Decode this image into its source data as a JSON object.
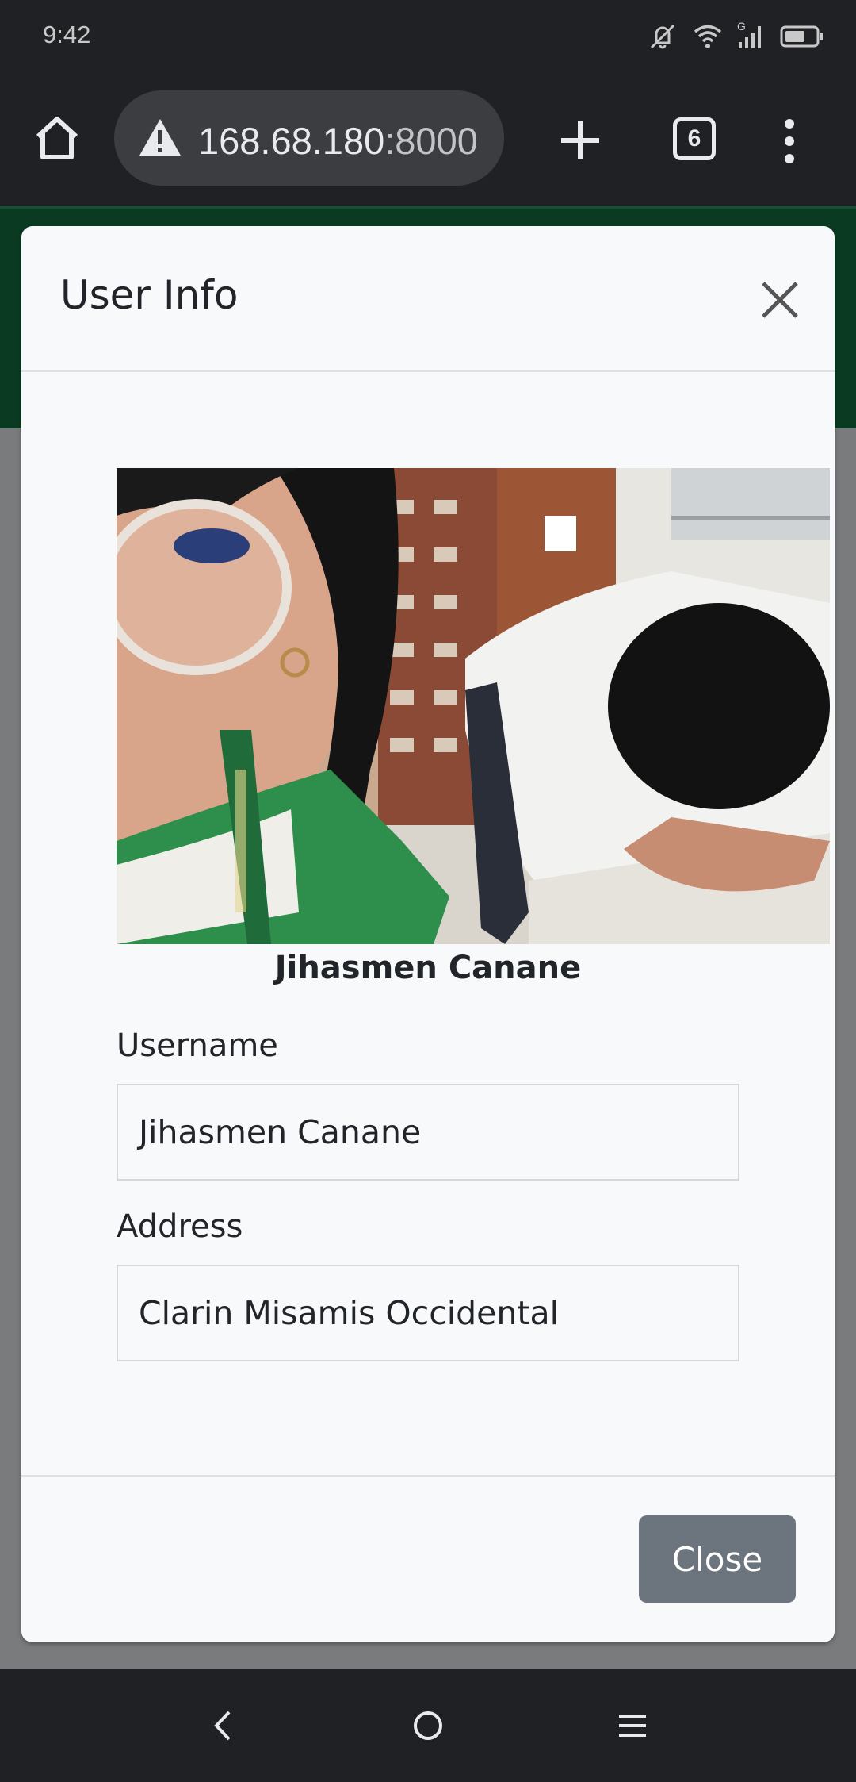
{
  "status_bar": {
    "time": "9:42",
    "icons": [
      "mute-vibrate-icon",
      "wifi-icon",
      "signal-icon",
      "battery-icon"
    ],
    "signal_network_label": "G"
  },
  "browser": {
    "url_host": "168.68.180",
    "url_port": ":8000",
    "tab_count": "6",
    "icons": [
      "home-icon",
      "warning-icon",
      "plus-icon",
      "menu-dots-icon"
    ]
  },
  "modal": {
    "title": "User Info",
    "display_name": "Jihasmen Canane",
    "fields": {
      "username_label": "Username",
      "username_value": "Jihasmen Canane",
      "address_label": "Address",
      "address_value": "Clarin Misamis Occidental"
    },
    "close_button_label": "Close"
  },
  "colors": {
    "header_green": "#0b3a22",
    "close_button_bg": "#6c757d",
    "modal_bg": "#f8f9fb"
  }
}
